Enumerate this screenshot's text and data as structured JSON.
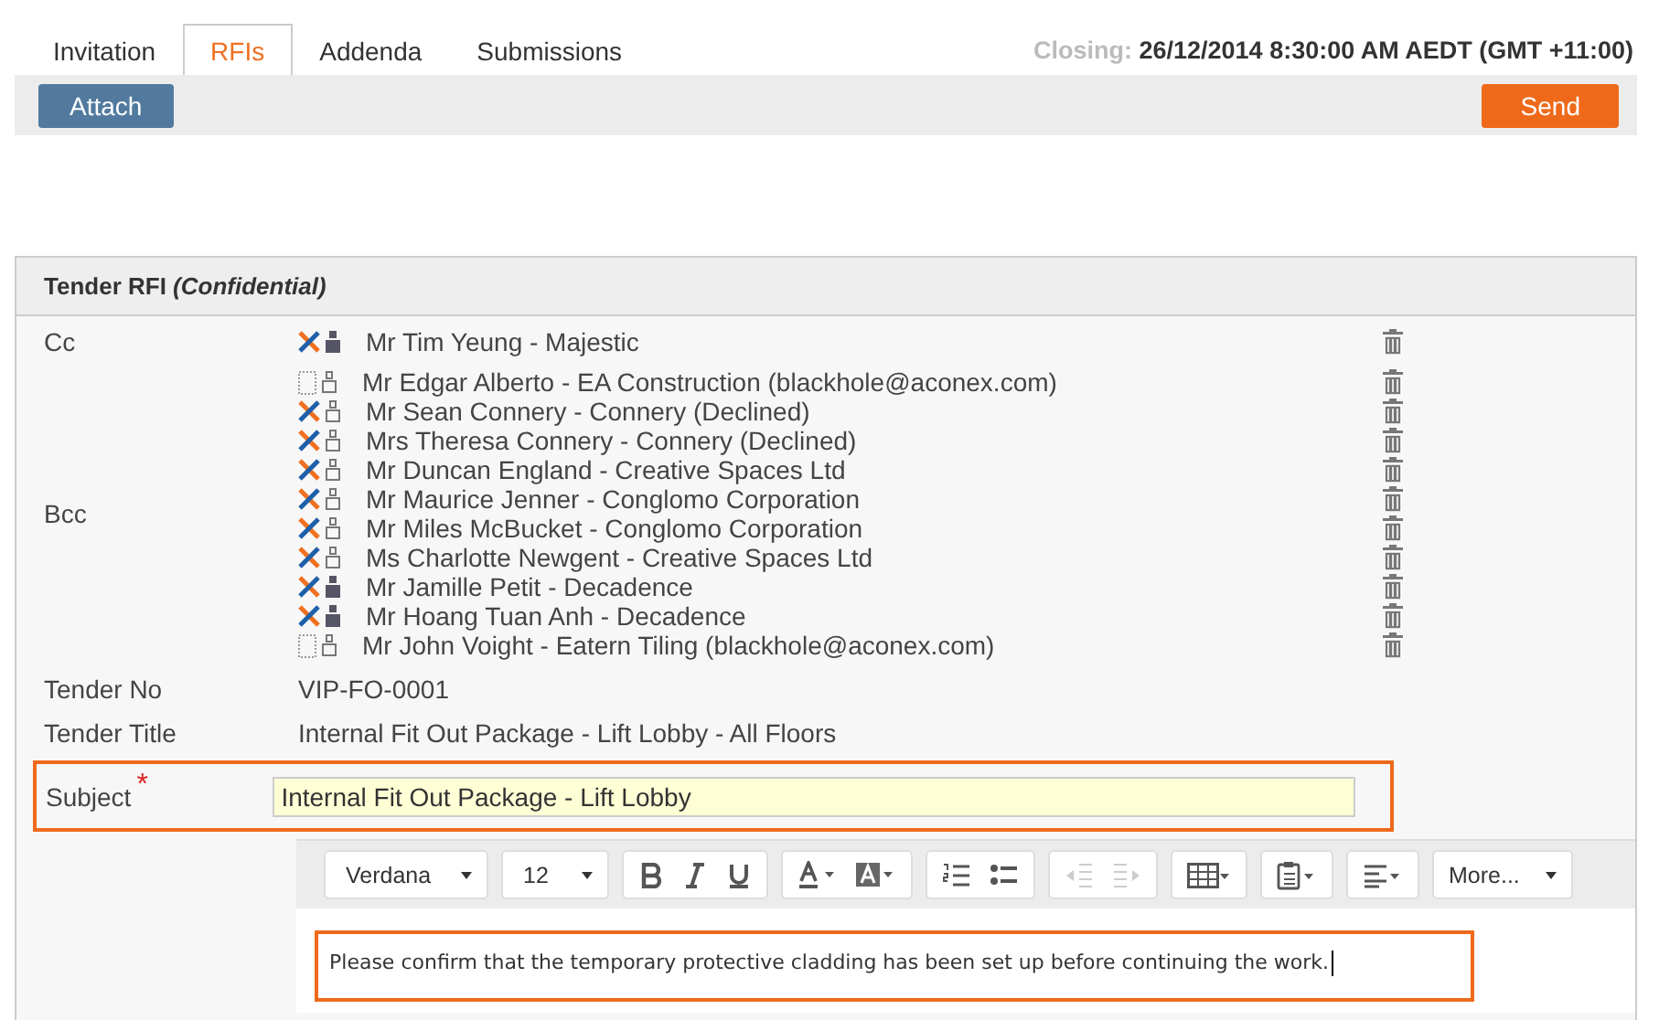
{
  "tabs": [
    {
      "label": "Invitation",
      "selected": false
    },
    {
      "label": "RFIs",
      "selected": true
    },
    {
      "label": "Addenda",
      "selected": false
    },
    {
      "label": "Submissions",
      "selected": false
    }
  ],
  "closing": {
    "label": "Closing:",
    "value": "26/12/2014 8:30:00 AM AEDT (GMT +11:00)"
  },
  "toolbar": {
    "attach": "Attach",
    "send": "Send"
  },
  "panel": {
    "title": "Tender RFI",
    "title_note": "(Confidential)",
    "cc": {
      "label": "Cc",
      "recipients": [
        {
          "name": "Mr Tim Yeung - Majestic",
          "kind": "member"
        }
      ]
    },
    "bcc": {
      "label": "Bcc",
      "recipients": [
        {
          "name": "Mr Edgar Alberto - EA Construction (blackhole@aconex.com)",
          "kind": "external"
        },
        {
          "name": "Mr Sean Connery - Connery (Declined)",
          "kind": "guest"
        },
        {
          "name": "Mrs Theresa Connery - Connery (Declined)",
          "kind": "guest"
        },
        {
          "name": "Mr Duncan England - Creative Spaces Ltd",
          "kind": "guest"
        },
        {
          "name": "Mr Maurice Jenner - Conglomo Corporation",
          "kind": "guest"
        },
        {
          "name": "Mr Miles McBucket - Conglomo Corporation",
          "kind": "guest"
        },
        {
          "name": "Ms Charlotte Newgent - Creative Spaces Ltd",
          "kind": "guest"
        },
        {
          "name": "Mr Jamille Petit - Decadence",
          "kind": "member"
        },
        {
          "name": "Mr Hoang Tuan Anh - Decadence",
          "kind": "member"
        },
        {
          "name": "Mr John Voight - Eatern Tiling (blackhole@aconex.com)",
          "kind": "external"
        }
      ]
    },
    "fields": [
      {
        "label": "Tender No",
        "value": "VIP-FO-0001"
      },
      {
        "label": "Tender Title",
        "value": "Internal Fit Out Package - Lift Lobby - All Floors"
      }
    ],
    "subject": {
      "label": "Subject",
      "required": true,
      "required_mark": "*",
      "value": "Internal Fit Out Package - Lift Lobby"
    },
    "editor": {
      "font": "Verdana",
      "size": "12",
      "more": "More...",
      "indent_disabled": true,
      "body": "Please confirm that the temporary protective cladding has been set up before continuing the work."
    }
  }
}
